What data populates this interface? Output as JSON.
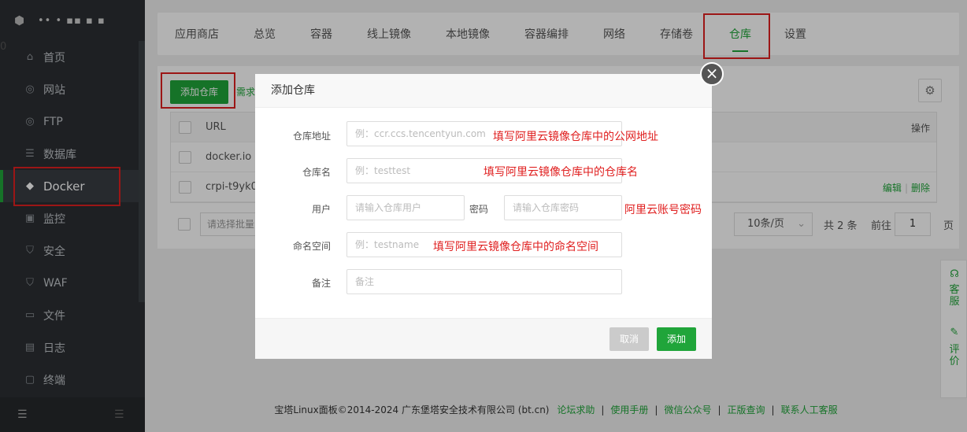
{
  "sidebar": {
    "host": "•• • ▪▪ ▪ ▪",
    "badge": "0",
    "items": [
      {
        "label": "首页",
        "icon": "home-icon"
      },
      {
        "label": "网站",
        "icon": "globe-icon"
      },
      {
        "label": "FTP",
        "icon": "globe-icon"
      },
      {
        "label": "数据库",
        "icon": "database-icon"
      },
      {
        "label": "Docker",
        "icon": "docker-icon"
      },
      {
        "label": "监控",
        "icon": "monitor-icon"
      },
      {
        "label": "安全",
        "icon": "shield-icon"
      },
      {
        "label": "WAF",
        "icon": "shield-icon"
      },
      {
        "label": "文件",
        "icon": "folder-icon"
      },
      {
        "label": "日志",
        "icon": "log-icon"
      },
      {
        "label": "终端",
        "icon": "terminal-icon"
      }
    ],
    "active_index": 4
  },
  "tabs": [
    "应用商店",
    "总览",
    "容器",
    "线上镜像",
    "本地镜像",
    "容器编排",
    "网络",
    "存储卷",
    "仓库",
    "设置"
  ],
  "active_tab": "仓库",
  "toolbar": {
    "add_label": "添加仓库",
    "req_label": "需求"
  },
  "table": {
    "headers": {
      "url": "URL",
      "op": "操作"
    },
    "rows": [
      {
        "url": "docker.io",
        "ops": []
      },
      {
        "url": "crpi-t9yk00",
        "ops": [
          "编辑",
          "删除"
        ]
      }
    ]
  },
  "pager": {
    "batch_placeholder": "请选择批量",
    "page_size": "10条/页",
    "total": "共 2 条",
    "goto": "前往",
    "page": "1",
    "page_suffix": "页"
  },
  "footer": {
    "copyright": "宝塔Linux面板©2014-2024 广东堡塔安全技术有限公司 (bt.cn)",
    "links": [
      "论坛求助",
      "使用手册",
      "微信公众号",
      "正版查询",
      "联系人工客服"
    ]
  },
  "side_float": {
    "service": "客服",
    "review": "评价"
  },
  "modal": {
    "title": "添加仓库",
    "fields": {
      "address": {
        "label": "仓库地址",
        "placeholder": "例：ccr.ccs.tencentyun.com"
      },
      "name": {
        "label": "仓库名",
        "placeholder": "例：testtest"
      },
      "user": {
        "label": "用户",
        "placeholder": "请输入仓库用户"
      },
      "password": {
        "label": "密码",
        "placeholder": "请输入仓库密码"
      },
      "namespace": {
        "label": "命名空间",
        "placeholder": "例：testname"
      },
      "remark": {
        "label": "备注",
        "placeholder": "备注"
      }
    },
    "notes": {
      "address": "填写阿里云镜像仓库中的公网地址",
      "name": "填写阿里云镜像仓库中的仓库名",
      "account": "阿里云账号密码",
      "namespace": "填写阿里云镜像仓库中的命名空间"
    },
    "cancel_label": "取消",
    "confirm_label": "添加"
  },
  "colors": {
    "accent": "#20a53a",
    "highlight": "#e02020",
    "sidebar_bg": "#2b2f33"
  }
}
